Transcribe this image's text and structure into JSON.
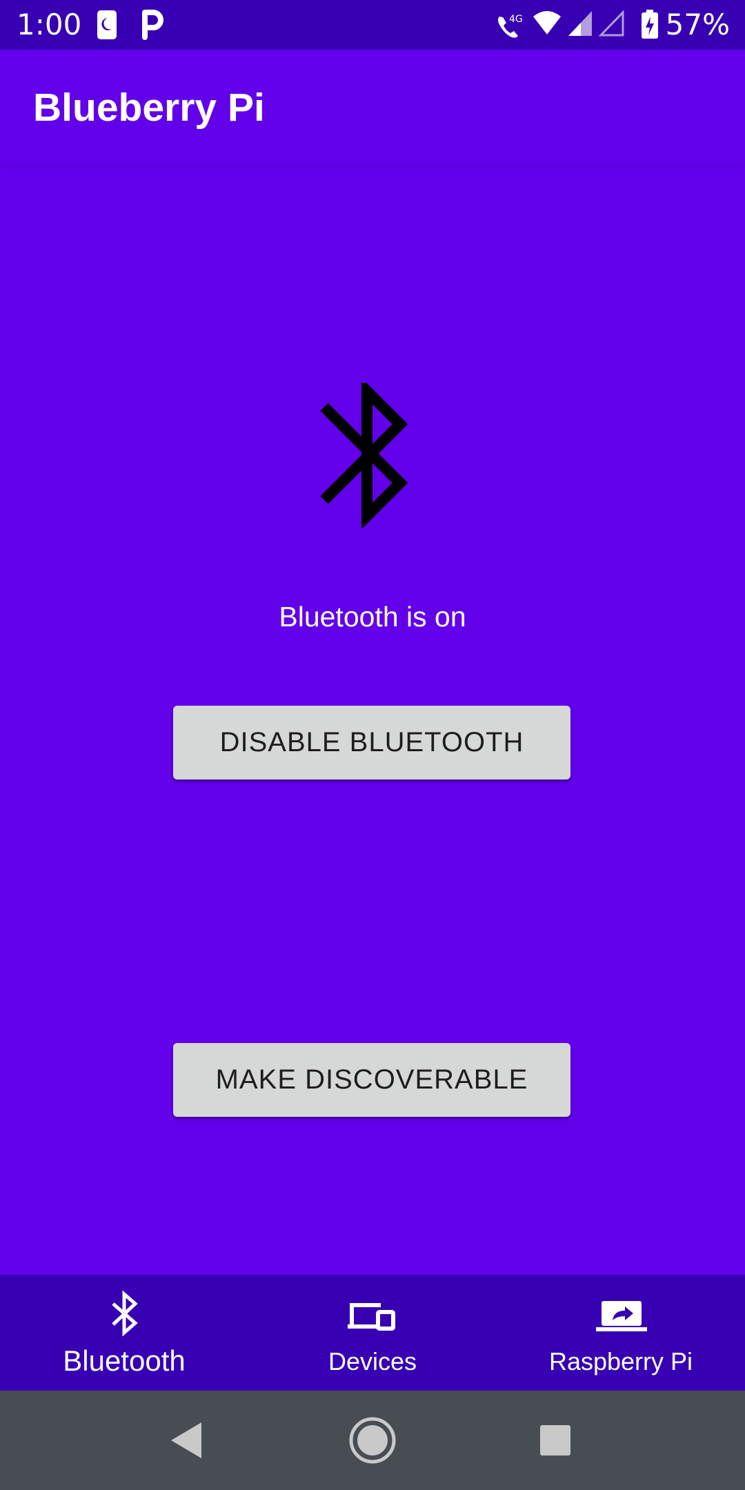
{
  "status_bar": {
    "time": "1:00",
    "battery_percent": "57%",
    "network_label": "4G",
    "icons": [
      "phone-moon-icon",
      "parking-icon",
      "wifi-call-icon",
      "wifi-icon",
      "signal-icon",
      "signal-empty-icon",
      "battery-charging-icon"
    ]
  },
  "app_bar": {
    "title": "Blueberry Pi"
  },
  "main": {
    "hero_icon": "bluetooth-icon",
    "status_text": "Bluetooth is on",
    "disable_button_label": "DISABLE BLUETOOTH",
    "discoverable_button_label": "MAKE DISCOVERABLE"
  },
  "bottom_nav": {
    "items": [
      {
        "label": "Bluetooth",
        "icon": "bluetooth-icon",
        "active": true
      },
      {
        "label": "Devices",
        "icon": "devices-icon",
        "active": false
      },
      {
        "label": "Raspberry Pi",
        "icon": "laptop-share-icon",
        "active": false
      }
    ]
  },
  "system_nav": {
    "buttons": [
      "back-icon",
      "home-icon",
      "recents-icon"
    ]
  },
  "colors": {
    "primary": "#6200ea",
    "primary_dark": "#3700b3",
    "button": "#d6d7d7",
    "system_nav": "#474d53"
  }
}
